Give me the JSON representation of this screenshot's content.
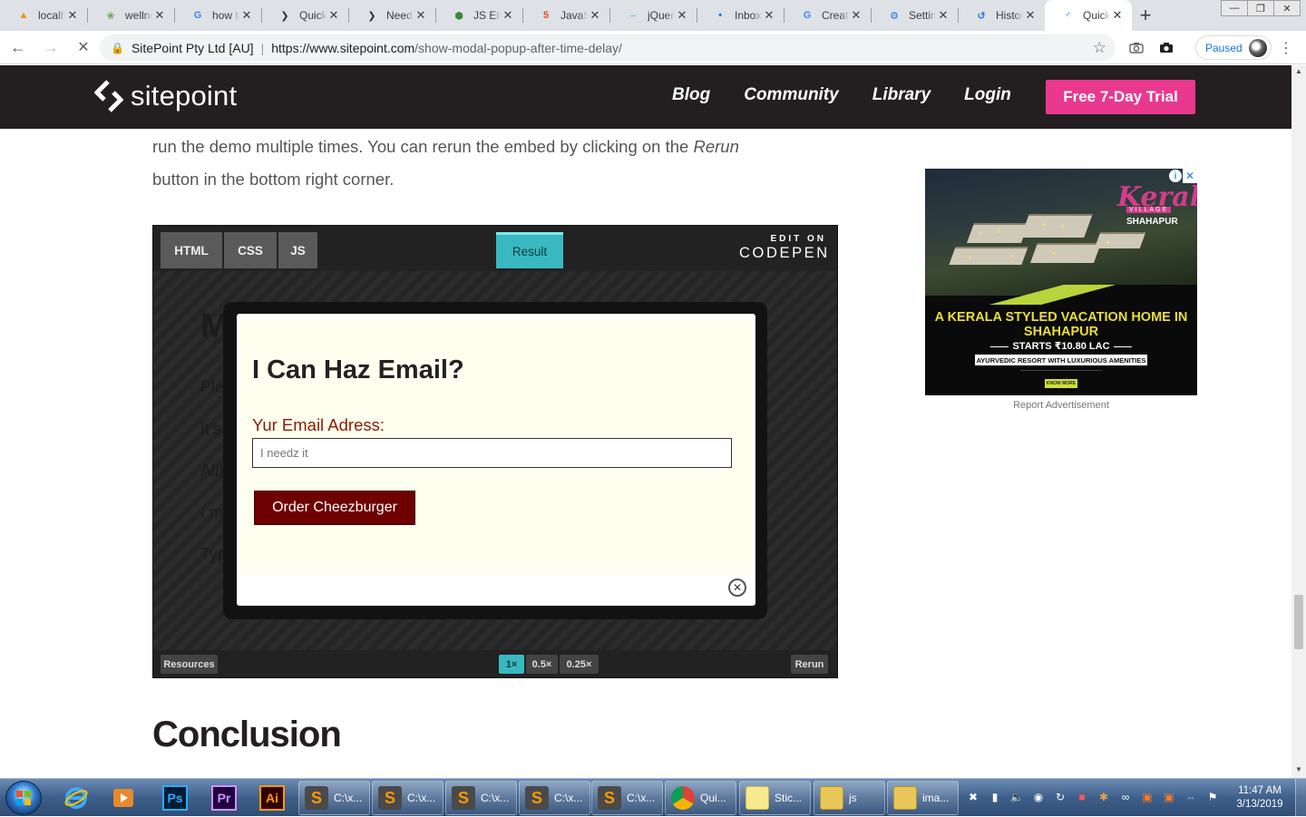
{
  "browser": {
    "tabs": [
      {
        "title": "localhost",
        "icon": "pma-icon",
        "color": "#f29111"
      },
      {
        "title": "wellness",
        "icon": "leaf-icon",
        "color": "#6aa84f"
      },
      {
        "title": "how to",
        "icon": "google-icon",
        "color": "#4285f4"
      },
      {
        "title": "Quick",
        "icon": "sitepoint-icon",
        "color": "#333333"
      },
      {
        "title": "Need",
        "icon": "sitepoint-icon",
        "color": "#333333"
      },
      {
        "title": "JS Elements",
        "icon": "nodejs-icon",
        "color": "#3c873a"
      },
      {
        "title": "JavaScript",
        "icon": "html5-icon",
        "color": "#e44d26"
      },
      {
        "title": "jQuery",
        "icon": "jquery-icon",
        "color": "#78cff5"
      },
      {
        "title": "Inbox",
        "icon": "gmail-icon",
        "color": "#1a73e8"
      },
      {
        "title": "Create",
        "icon": "google-icon",
        "color": "#4285f4"
      },
      {
        "title": "Settings",
        "icon": "gear-icon",
        "color": "#1a73e8"
      },
      {
        "title": "History",
        "icon": "history-icon",
        "color": "#1a73e8"
      },
      {
        "title": "Quick",
        "icon": "loading-icon",
        "color": "#1a73e8",
        "active": true
      }
    ],
    "address": {
      "site_name": "SitePoint Pty Ltd [AU]",
      "url_host": "https://www.sitepoint.com",
      "url_path": "/show-modal-popup-after-time-delay/"
    },
    "profile_status": "Paused"
  },
  "site": {
    "logo": "sitepoint",
    "nav": [
      {
        "label": "Blog"
      },
      {
        "label": "Community"
      },
      {
        "label": "Library"
      },
      {
        "label": "Login"
      }
    ],
    "trial_button": "Free 7-Day Trial",
    "accent": "#e8398f"
  },
  "article": {
    "para_line1": "run the demo multiple times. You can rerun the embed by clicking on the ",
    "para_rerun": "Rerun",
    "para_line2": "button in the bottom right corner.",
    "conclusion_heading": "Conclusion"
  },
  "codepen": {
    "tabs": [
      "HTML",
      "CSS",
      "JS"
    ],
    "result_tab": "Result",
    "edit_on": "EDIT ON",
    "brand": "CODEPEN",
    "resources": "Resources",
    "zoom": [
      "1×",
      "0.5×",
      "0.25×"
    ],
    "rerun": "Rerun",
    "modal": {
      "title": "I Can Haz Email?",
      "label": "Yur Email Adress:",
      "placeholder": "I needz it",
      "button": "Order Cheezburger"
    }
  },
  "ad": {
    "brand": "Kerala",
    "brand_sub": "VILLAGE",
    "location": "SHAHAPUR",
    "headline": "A KERALA STYLED VACATION HOME IN SHAHAPUR",
    "price": "STARTS ₹10.80 LAC",
    "tagline": "AYURVEDIC RESORT WITH LUXURIOUS AMENITIES",
    "cta": "KNOW MORE",
    "report": "Report Advertisement"
  },
  "taskbar": {
    "items": [
      {
        "label": "C:\\x...",
        "icon": "sublime-icon"
      },
      {
        "label": "C:\\x...",
        "icon": "sublime-icon"
      },
      {
        "label": "C:\\x...",
        "icon": "sublime-icon"
      },
      {
        "label": "C:\\x...",
        "icon": "sublime-icon"
      },
      {
        "label": "C:\\x...",
        "icon": "sublime-icon"
      },
      {
        "label": "Qui...",
        "icon": "chrome-icon"
      },
      {
        "label": "Stic...",
        "icon": "sticky-notes-icon"
      },
      {
        "label": "js",
        "icon": "folder-icon"
      },
      {
        "label": "ima...",
        "icon": "folder-icon"
      }
    ],
    "time": "11:47 AM",
    "date": "3/13/2019"
  }
}
